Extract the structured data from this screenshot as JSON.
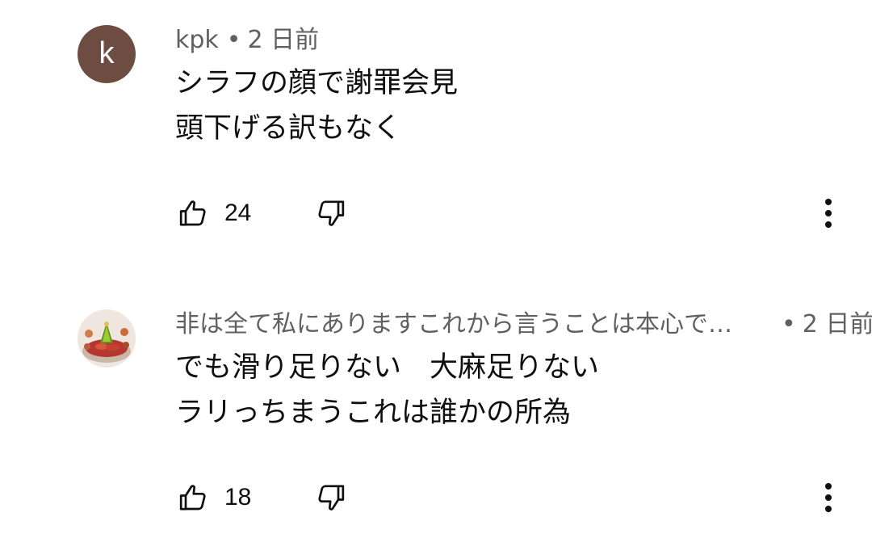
{
  "comments": [
    {
      "author": "kpk",
      "avatar_letter": "k",
      "avatar_color": "#6d4c41",
      "time": "2 日前",
      "lines": [
        "シラフの顔で謝罪会見",
        "頭下げる訳もなく"
      ],
      "likes": "24"
    },
    {
      "author": "非は全て私にありますこれから言うことは本心で…",
      "avatar_image": "food-platter-avatar",
      "time": "2 日前",
      "lines": [
        "でも滑り足りない　大麻足りない",
        "ラリっちまうこれは誰かの所為"
      ],
      "likes": "18"
    }
  ],
  "meta_separator": "•",
  "icons": {
    "like": "thumbs-up-icon",
    "dislike": "thumbs-down-icon",
    "more": "more-vert-icon"
  }
}
